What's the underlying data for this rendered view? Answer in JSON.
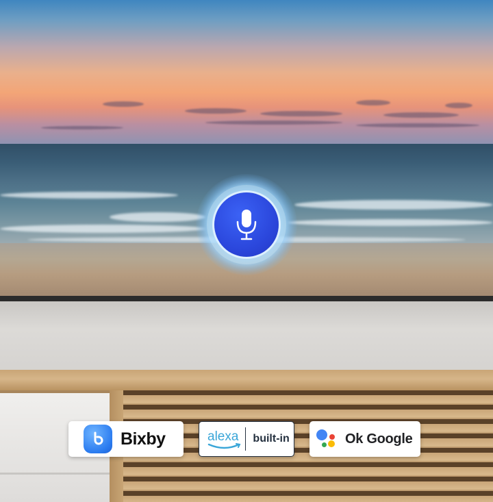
{
  "screen": {
    "scene": "ocean-sunset",
    "mic_button": {
      "icon": "microphone-icon",
      "color": "#2b47dc",
      "state": "listening"
    }
  },
  "assistants": [
    {
      "id": "bixby",
      "label": "Bixby",
      "icon": "bixby-icon",
      "color": "#2b7cf0"
    },
    {
      "id": "alexa",
      "brand": "alexa",
      "label": "built-in",
      "icon": "alexa-smile-icon",
      "color": "#3aa6d8"
    },
    {
      "id": "google",
      "label": "Ok Google",
      "icon": "google-assistant-icon",
      "dot_colors": [
        "#4285f4",
        "#ea4335",
        "#fbbc05",
        "#34a853"
      ]
    }
  ]
}
